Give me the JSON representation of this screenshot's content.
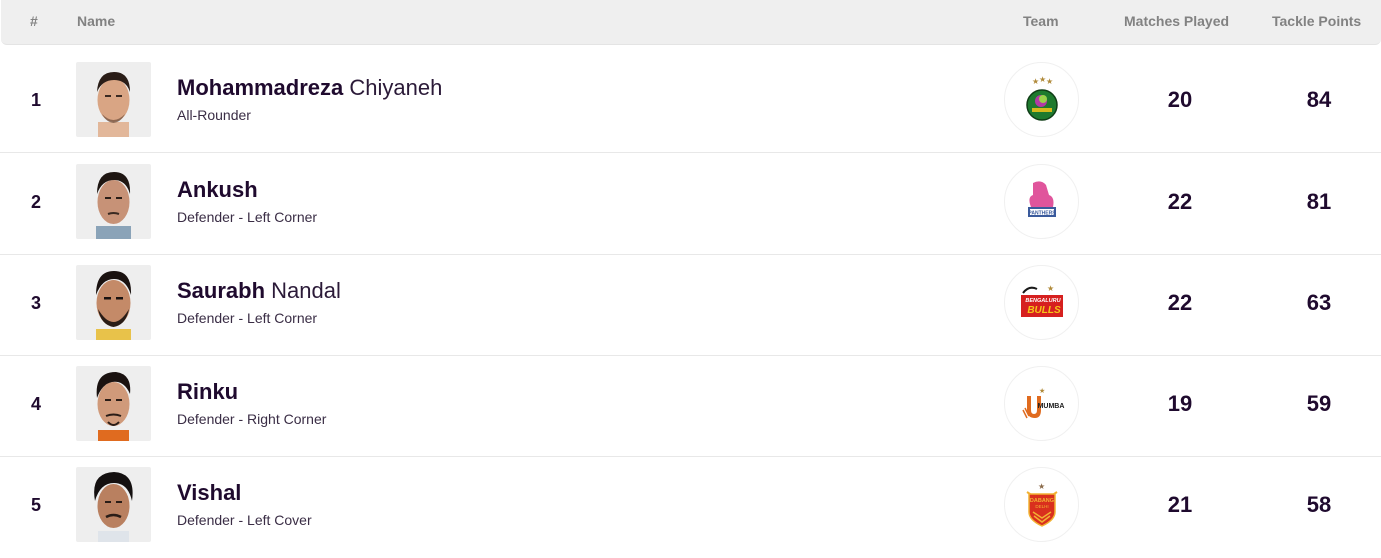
{
  "header": {
    "rank": "#",
    "name": "Name",
    "team": "Team",
    "matches_played": "Matches Played",
    "tackle_points": "Tackle Points"
  },
  "players": [
    {
      "rank": "1",
      "first_name": "Mohammadreza",
      "last_name": "Chiyaneh",
      "position": "All-Rounder",
      "team_logo": "patna-pirates-logo",
      "team_colors": {
        "primary": "#1e7a2e",
        "accent": "#b23aa6"
      },
      "matches_played": "20",
      "tackle_points": "84"
    },
    {
      "rank": "2",
      "first_name": "Ankush",
      "last_name": "",
      "position": "Defender - Left Corner",
      "team_logo": "jaipur-pink-panthers-logo",
      "team_colors": {
        "primary": "#e0559c",
        "accent": "#3a5a9c"
      },
      "matches_played": "22",
      "tackle_points": "81"
    },
    {
      "rank": "3",
      "first_name": "Saurabh",
      "last_name": "Nandal",
      "position": "Defender - Left Corner",
      "team_logo": "bengaluru-bulls-logo",
      "team_colors": {
        "primary": "#d6201f",
        "accent": "#f5c518"
      },
      "matches_played": "22",
      "tackle_points": "63"
    },
    {
      "rank": "4",
      "first_name": "Rinku",
      "last_name": "",
      "position": "Defender - Right Corner",
      "team_logo": "u-mumba-logo",
      "team_colors": {
        "primary": "#e06b1f",
        "accent": "#1a1a1a"
      },
      "matches_played": "19",
      "tackle_points": "59"
    },
    {
      "rank": "5",
      "first_name": "Vishal",
      "last_name": "",
      "position": "Defender - Left Cover",
      "team_logo": "dabang-delhi-logo",
      "team_colors": {
        "primary": "#d9301e",
        "accent": "#f2b233"
      },
      "matches_played": "21",
      "tackle_points": "58"
    }
  ]
}
